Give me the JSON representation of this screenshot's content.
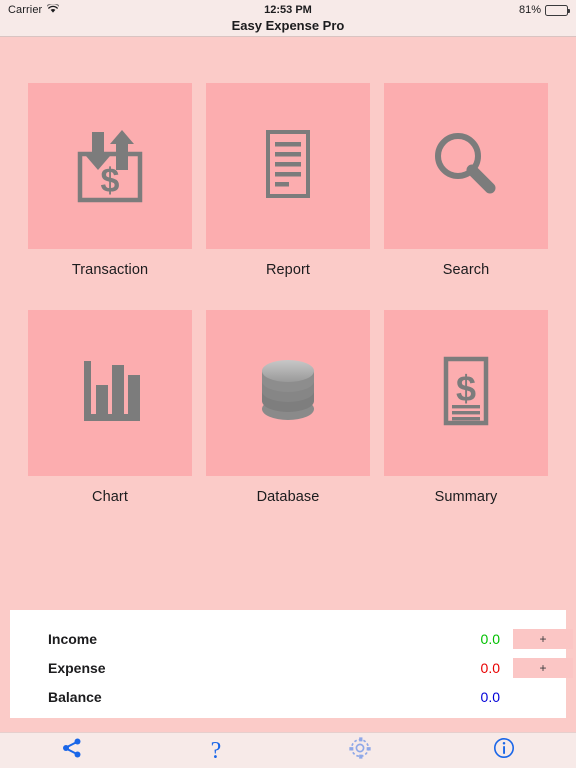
{
  "status_bar": {
    "carrier": "Carrier",
    "wifi_icon": "wifi-icon",
    "time": "12:53 PM",
    "battery_percent": "81%",
    "battery_level": 81,
    "battery_icon": "battery-icon"
  },
  "nav": {
    "title": "Easy Expense Pro"
  },
  "grid": {
    "tiles": [
      {
        "label": "Transaction",
        "icon": "transaction-arrows-dollar-icon"
      },
      {
        "label": "Report",
        "icon": "document-lines-icon"
      },
      {
        "label": "Search",
        "icon": "magnifier-icon"
      },
      {
        "label": "Chart",
        "icon": "bar-chart-icon"
      },
      {
        "label": "Database",
        "icon": "database-cylinder-icon"
      },
      {
        "label": "Summary",
        "icon": "document-dollar-icon"
      }
    ]
  },
  "summary": {
    "rows": [
      {
        "label": "Income",
        "value": "0.0",
        "add_label": "+",
        "has_add": true
      },
      {
        "label": "Expense",
        "value": "0.0",
        "add_label": "+",
        "has_add": true
      },
      {
        "label": "Balance",
        "value": "0.0",
        "add_label": "",
        "has_add": false
      }
    ]
  },
  "toolbar": {
    "items": [
      {
        "icon": "share-icon"
      },
      {
        "icon": "help-question-icon",
        "label": "?"
      },
      {
        "icon": "gear-icon"
      },
      {
        "icon": "info-icon"
      }
    ]
  },
  "colors": {
    "page_background": "#fbcbc8",
    "tile_background": "#fcadaf",
    "chrome_background": "#f7eae8",
    "panel_background": "#ffffff",
    "icon_gray": "#7c7c7c",
    "income_green": "#00c000",
    "expense_red": "#e80000",
    "balance_blue": "#0000d8",
    "accent_blue": "#1a66e8",
    "gear_blue": "#8fa8e8",
    "plus_button": "#fbc6c5"
  }
}
